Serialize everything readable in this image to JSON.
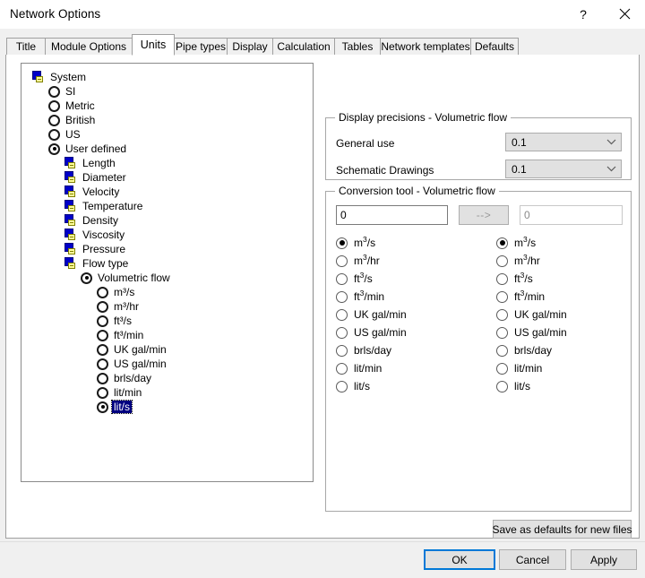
{
  "window": {
    "title": "Network Options",
    "help_icon": "question-mark-icon",
    "close_icon": "close-icon"
  },
  "tabs": [
    {
      "label": "Title",
      "active": false
    },
    {
      "label": "Module Options",
      "active": false
    },
    {
      "label": "Units",
      "active": true
    },
    {
      "label": "Pipe types",
      "active": false
    },
    {
      "label": "Display",
      "active": false
    },
    {
      "label": "Calculation",
      "active": false
    },
    {
      "label": "Tables",
      "active": false
    },
    {
      "label": "Network templates",
      "active": false
    },
    {
      "label": "Defaults",
      "active": false
    }
  ],
  "tree": {
    "nodes": [
      {
        "label": "System",
        "type": "node",
        "depth": 0,
        "checked": false,
        "selected": false
      },
      {
        "label": "SI",
        "type": "radio",
        "depth": 1,
        "checked": false,
        "selected": false
      },
      {
        "label": "Metric",
        "type": "radio",
        "depth": 1,
        "checked": false,
        "selected": false
      },
      {
        "label": "British",
        "type": "radio",
        "depth": 1,
        "checked": false,
        "selected": false
      },
      {
        "label": "US",
        "type": "radio",
        "depth": 1,
        "checked": false,
        "selected": false
      },
      {
        "label": "User defined",
        "type": "radio",
        "depth": 1,
        "checked": true,
        "selected": false
      },
      {
        "label": "Length",
        "type": "node",
        "depth": 2,
        "checked": false,
        "selected": false
      },
      {
        "label": "Diameter",
        "type": "node",
        "depth": 2,
        "checked": false,
        "selected": false
      },
      {
        "label": "Velocity",
        "type": "node",
        "depth": 2,
        "checked": false,
        "selected": false
      },
      {
        "label": "Temperature",
        "type": "node",
        "depth": 2,
        "checked": false,
        "selected": false
      },
      {
        "label": "Density",
        "type": "node",
        "depth": 2,
        "checked": false,
        "selected": false
      },
      {
        "label": "Viscosity",
        "type": "node",
        "depth": 2,
        "checked": false,
        "selected": false
      },
      {
        "label": "Pressure",
        "type": "node",
        "depth": 2,
        "checked": false,
        "selected": false
      },
      {
        "label": "Flow type",
        "type": "node",
        "depth": 2,
        "checked": false,
        "selected": false
      },
      {
        "label": "Volumetric flow",
        "type": "radio",
        "depth": 3,
        "checked": true,
        "selected": false
      },
      {
        "label": "m³/s",
        "type": "radio",
        "depth": 4,
        "checked": false,
        "selected": false
      },
      {
        "label": "m³/hr",
        "type": "radio",
        "depth": 4,
        "checked": false,
        "selected": false
      },
      {
        "label": "ft³/s",
        "type": "radio",
        "depth": 4,
        "checked": false,
        "selected": false
      },
      {
        "label": "ft³/min",
        "type": "radio",
        "depth": 4,
        "checked": false,
        "selected": false
      },
      {
        "label": "UK gal/min",
        "type": "radio",
        "depth": 4,
        "checked": false,
        "selected": false
      },
      {
        "label": "US gal/min",
        "type": "radio",
        "depth": 4,
        "checked": false,
        "selected": false
      },
      {
        "label": "brls/day",
        "type": "radio",
        "depth": 4,
        "checked": false,
        "selected": false
      },
      {
        "label": "lit/min",
        "type": "radio",
        "depth": 4,
        "checked": false,
        "selected": false
      },
      {
        "label": "lit/s",
        "type": "radio",
        "depth": 4,
        "checked": true,
        "selected": true
      }
    ]
  },
  "precision_group": {
    "title": "Display precisions - Volumetric flow",
    "rows": [
      {
        "label": "General use",
        "value": "0.1"
      },
      {
        "label": "Schematic Drawings",
        "value": "0.1"
      }
    ]
  },
  "conversion_group": {
    "title": "Conversion tool - Volumetric flow",
    "input_value": "0",
    "output_value": "0",
    "convert_button_label": "-->",
    "units": [
      {
        "label": "m³/s",
        "base": "m",
        "sup": "3",
        "suffix": "/s"
      },
      {
        "label": "m³/hr",
        "base": "m",
        "sup": "3",
        "suffix": "/hr"
      },
      {
        "label": "ft³/s",
        "base": "ft",
        "sup": "3",
        "suffix": "/s"
      },
      {
        "label": "ft³/min",
        "base": "ft",
        "sup": "3",
        "suffix": "/min"
      },
      {
        "label": "UK gal/min",
        "base": "UK gal/min",
        "sup": "",
        "suffix": ""
      },
      {
        "label": "US gal/min",
        "base": "US gal/min",
        "sup": "",
        "suffix": ""
      },
      {
        "label": "brls/day",
        "base": "brls/day",
        "sup": "",
        "suffix": ""
      },
      {
        "label": "lit/min",
        "base": "lit/min",
        "sup": "",
        "suffix": ""
      },
      {
        "label": "lit/s",
        "base": "lit/s",
        "sup": "",
        "suffix": ""
      }
    ],
    "from_selected_index": 0,
    "to_selected_index": 0
  },
  "buttons": {
    "save_defaults": "Save as defaults for new files",
    "ok": "OK",
    "cancel": "Cancel",
    "apply": "Apply"
  },
  "colors": {
    "selection_blue": "#000080",
    "focus_blue": "#0078d7",
    "node_icon_blue": "#0000c8",
    "node_icon_yellow": "#ffff9a",
    "dialog_gray": "#f0f0f0"
  }
}
